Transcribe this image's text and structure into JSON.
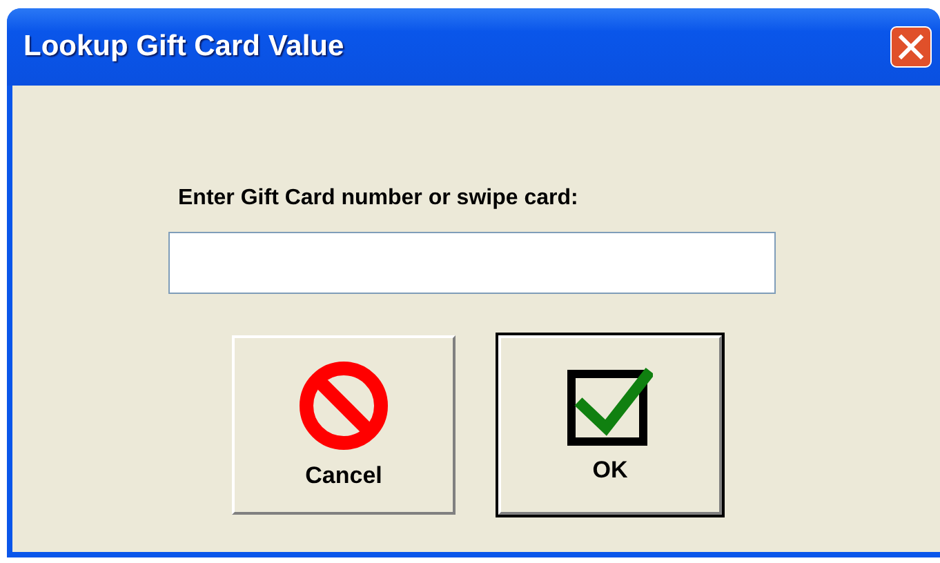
{
  "window": {
    "title": "Lookup Gift Card Value"
  },
  "prompt": "Enter Gift Card number or swipe card:",
  "buttons": [
    {
      "kind": "cancel",
      "label": "Cancel",
      "default": false
    },
    {
      "kind": "ok",
      "label": "OK",
      "default": true
    }
  ]
}
